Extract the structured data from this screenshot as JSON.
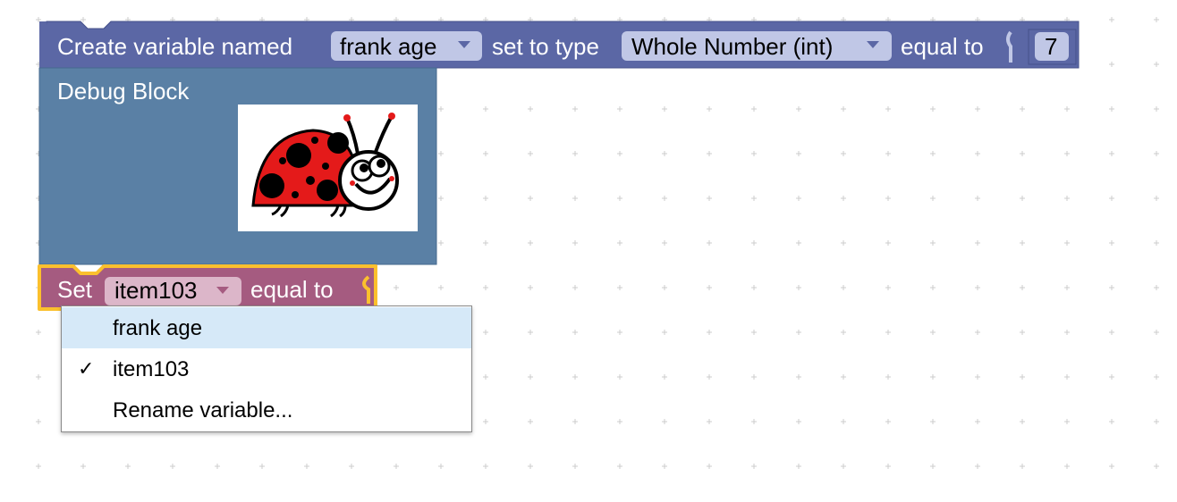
{
  "workspace": {
    "background": "#ffffff",
    "grid_color": "#cccccc"
  },
  "blocks": {
    "create_variable": {
      "color": "#5b67a5",
      "label_prefix": "Create variable named",
      "name_field": "frank age",
      "label_type": "set to type",
      "type_field": "Whole Number (int)",
      "label_equal": "equal to",
      "value_field": "7"
    },
    "debug_block": {
      "color": "#5a80a5",
      "label": "Debug Block",
      "image_icon": "ladybug-image"
    },
    "set_block": {
      "color": "#a55b80",
      "highlight_color": "#fbc02d",
      "label_prefix": "Set",
      "variable_field": "item103",
      "label_equal": "equal to"
    }
  },
  "dropdown_menu": {
    "items": [
      {
        "label": "frank age",
        "checked": false,
        "highlighted": true
      },
      {
        "label": "item103",
        "checked": true,
        "highlighted": false
      },
      {
        "label": "Rename variable...",
        "checked": false,
        "highlighted": false
      }
    ],
    "check_glyph": "✓",
    "highlight_color": "#d6e9f8"
  }
}
